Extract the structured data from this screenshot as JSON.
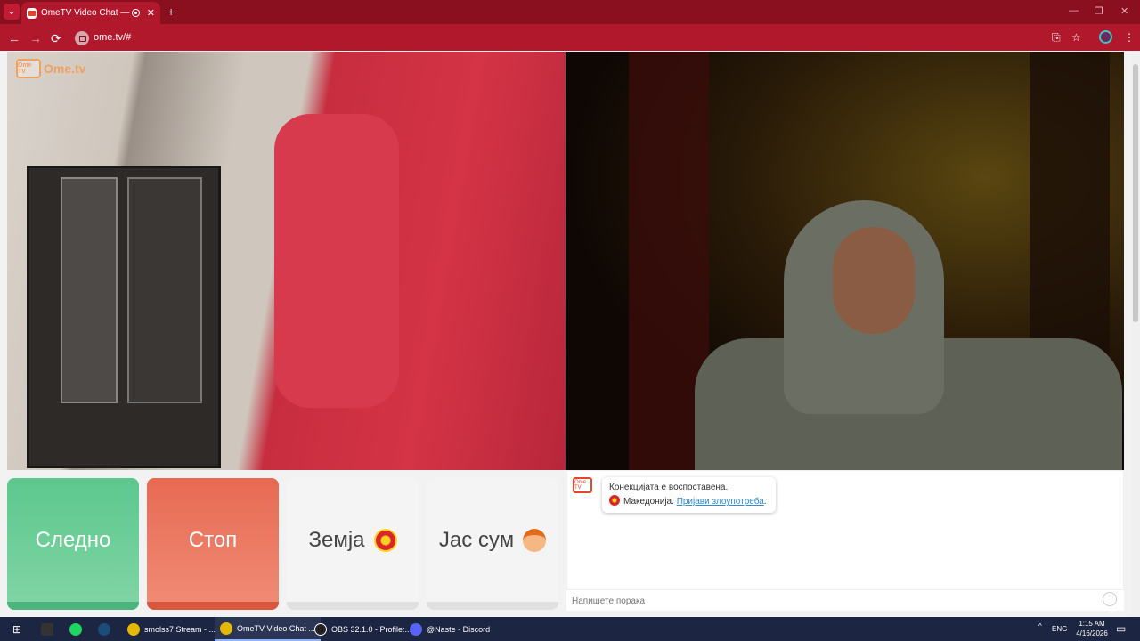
{
  "browser": {
    "tab_title": "OmeTV Video Chat — Ome",
    "tab_close": "✕",
    "new_tab": "+",
    "url": "ome.tv/#",
    "nav": {
      "back": "←",
      "forward": "→",
      "reload": "⟳"
    },
    "win": {
      "minimize": "—",
      "restore": "❐",
      "close": "✕"
    },
    "icons": {
      "install": "⎘",
      "bookmark": "☆",
      "menu": "⋮"
    }
  },
  "site": {
    "logo_badge": "Ome TV",
    "logo_text": "Ome.tv",
    "buttons": {
      "next": "Следно",
      "stop": "Стоп",
      "country": "Земја",
      "i_am": "Јас сум"
    },
    "chat": {
      "logo_badge": "Ome TV",
      "status": "Конекцијата е воспоставена.",
      "country": "Македонија.",
      "report": "Пријави злоупотреба",
      "report_suffix": ".",
      "placeholder": "Напишете порака"
    }
  },
  "taskbar": {
    "items": [
      {
        "label": "smolss7 Stream - ...",
        "color": "#e6b800"
      },
      {
        "label": "OmeTV Video Chat ...",
        "color": "#e6b800"
      },
      {
        "label": "OBS 32.1.0 - Profile:...",
        "color": "#222"
      },
      {
        "label": "@Naste - Discord",
        "color": "#5865f2"
      }
    ],
    "tray_lang": "ENG",
    "time": "1:15 AM",
    "date": "4/16/2026",
    "tray_arrow": "^",
    "notify": "▭"
  }
}
